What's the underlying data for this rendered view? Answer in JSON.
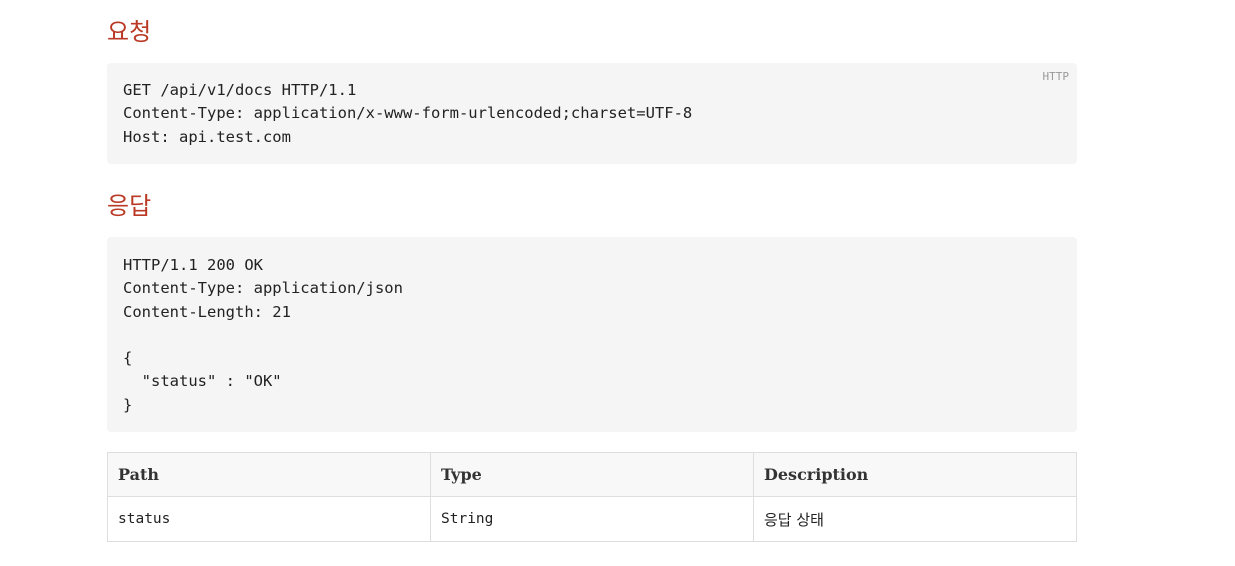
{
  "request": {
    "heading": "요청",
    "language": "HTTP",
    "lines": [
      "GET /api/v1/docs HTTP/1.1",
      "Content-Type: application/x-www-form-urlencoded;charset=UTF-8",
      "Host: api.test.com"
    ]
  },
  "response": {
    "heading": "응답",
    "lines": [
      "HTTP/1.1 200 OK",
      "Content-Type: application/json",
      "Content-Length: 21",
      "",
      "{",
      "  \"status\" : \"OK\"",
      "}"
    ]
  },
  "fields_table": {
    "headers": [
      "Path",
      "Type",
      "Description"
    ],
    "rows": [
      [
        "status",
        "String",
        "응답 상태"
      ]
    ]
  }
}
